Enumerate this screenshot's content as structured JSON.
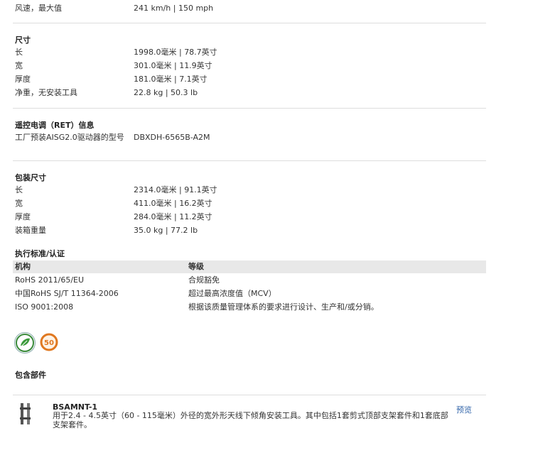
{
  "wind": {
    "label": "风速，最大值",
    "value": "241 km/h   |   150 mph"
  },
  "dimensions": {
    "title": "尺寸",
    "rows": [
      {
        "label": "长",
        "value": "1998.0毫米   |   78.7英寸"
      },
      {
        "label": "宽",
        "value": "301.0毫米   |   11.9英寸"
      },
      {
        "label": "厚度",
        "value": "181.0毫米   |   7.1英寸"
      },
      {
        "label": "净重，无安装工具",
        "value": "22.8 kg   |   50.3 lb"
      }
    ]
  },
  "ret": {
    "title": "遥控电调（RET）信息",
    "label": "工厂预装AISG2.0驱动器的型号",
    "value": "DBXDH-6565B-A2M"
  },
  "packaging": {
    "title": "包装尺寸",
    "rows": [
      {
        "label": "长",
        "value": "2314.0毫米   |   91.1英寸"
      },
      {
        "label": "宽",
        "value": "411.0毫米   |   16.2英寸"
      },
      {
        "label": "厚度",
        "value": "284.0毫米   |   11.2英寸"
      },
      {
        "label": "装箱重量",
        "value": "35.0 kg   |   77.2 lb"
      }
    ]
  },
  "standards": {
    "title": "执行标准/认证",
    "headers": [
      "机构",
      "等级"
    ],
    "rows": [
      [
        "RoHS 2011/65/EU",
        "合规豁免"
      ],
      [
        "中国RoHS SJ/T 11364-2006",
        "超过最高浓度值（MCV）"
      ],
      [
        "ISO 9001:2008",
        "根据该质量管理体系的要求进行设计、生产和/或分销。"
      ]
    ]
  },
  "icons": [
    "rohs-leaf-icon",
    "china-rohs-50-icon"
  ],
  "included": {
    "title": "包含部件",
    "part_name": "BSAMNT-1",
    "part_desc": "用于2.4 - 4.5英寸（60 - 115毫米）外径的宽外形天线下倾角安装工具。其中包括1套剪式顶部支架套件和1套底部支架套件。",
    "preview": "预览"
  }
}
